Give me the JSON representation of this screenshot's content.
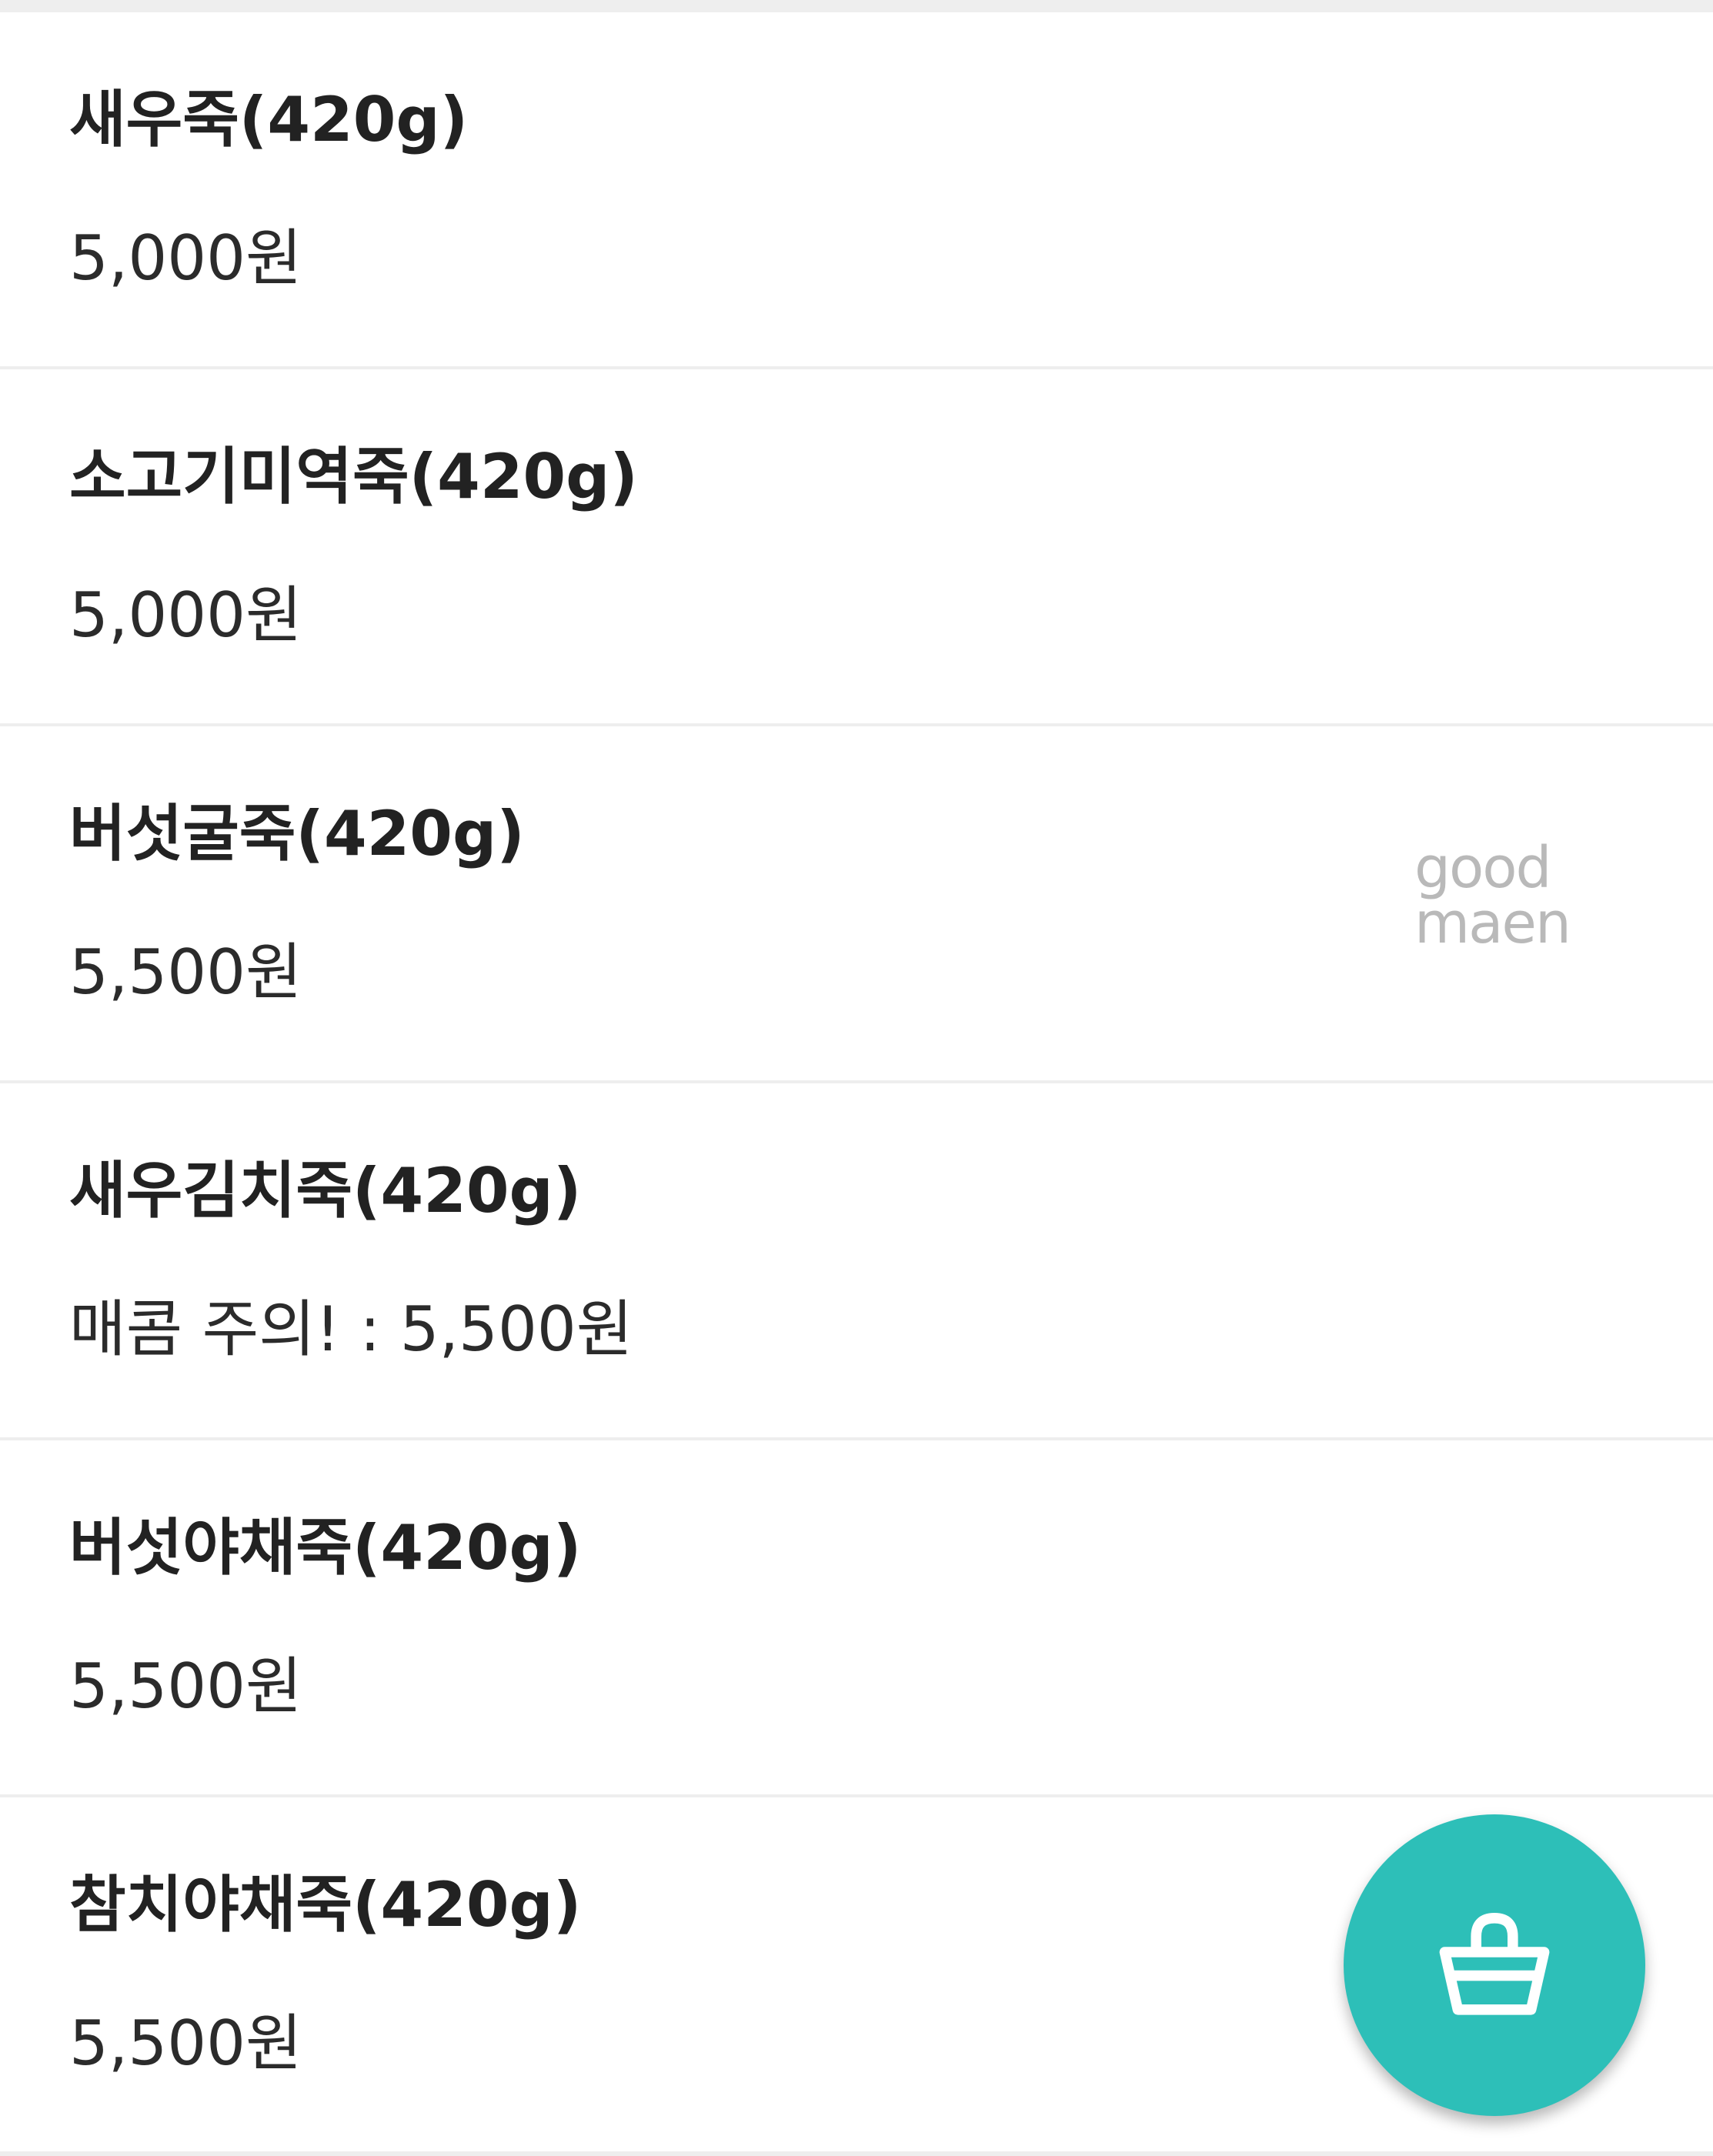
{
  "menu": {
    "items": [
      {
        "name": "새우죽(420g)",
        "price": "5,000원"
      },
      {
        "name": "소고기미역죽(420g)",
        "price": "5,000원"
      },
      {
        "name": "버섯굴죽(420g)",
        "price": "5,500원"
      },
      {
        "name": "새우김치죽(420g)",
        "price": "매콤 주의! : 5,500원"
      },
      {
        "name": "버섯야채죽(420g)",
        "price": "5,500원"
      },
      {
        "name": "참치야채죽(420g)",
        "price": "5,500원"
      }
    ]
  },
  "watermark": {
    "line1": "good",
    "line2": "maen"
  },
  "cart_button": {
    "icon": "shopping-basket-icon",
    "color": "#2dbfb8"
  }
}
